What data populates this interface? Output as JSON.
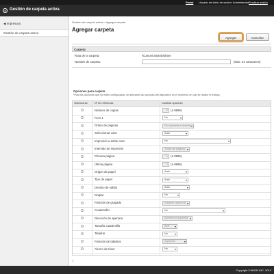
{
  "topbar": {
    "portal": "Portal",
    "user": "Usuario de inicio de sesión: Administrator",
    "logout": "Finalizar sesión"
  },
  "app": {
    "title": "Gestión de carpeta activa"
  },
  "sidebar": {
    "back": "◀ Impresora",
    "active": "Gestión de carpeta activa"
  },
  "breadcrumb": "Gestión de carpeta activa > Agregar carpeta",
  "page_title": "Agregar carpeta",
  "buttons": {
    "ok": "Agregar",
    "cancel": "Cancelar"
  },
  "folder": {
    "header": "Carpeta",
    "route_label": "Ruta de la carpeta:",
    "route_value": "\\\\CanonC5540D\\share",
    "name_label": "Nombre de carpeta:",
    "name_hint": "(Máx. 64 caracteres)"
  },
  "options": {
    "title": "Opciones para carpeta",
    "note": "*Para las opciones que no estén configuradas, se aplicarán las opciones del dispositivo en el momento en que se realice el trabajo.",
    "col_select": "Seleccionar",
    "col_ref": "Nº de referencia",
    "col_change": "Cambiar opciones",
    "rows": [
      {
        "label": "Número de copias",
        "value": "1",
        "range": "(1-9999)"
      },
      {
        "label": "N en 1",
        "value": "No"
      },
      {
        "label": "Orden de páginas",
        "value": "De izquierda a derecha"
      },
      {
        "label": "Seleccionar color",
        "value": "Auto"
      },
      {
        "label": "Impresión a doble cara",
        "value": "No"
      },
      {
        "label": "Intervalo de impresión",
        "value": "Todas las páginas"
      },
      {
        "label": "Primera página",
        "value": "1",
        "range": "(1-9999)"
      },
      {
        "label": "Última página",
        "value": "1",
        "range": "(1-9999)"
      },
      {
        "label": "Origen de papel",
        "value": "Auto"
      },
      {
        "label": "Tipo de papel",
        "value": "Auto"
      },
      {
        "label": "Destino de salida",
        "value": "Auto"
      },
      {
        "label": "Grapar",
        "value": "No"
      },
      {
        "label": "Posición de grapado",
        "value": "Superior izquierda"
      },
      {
        "label": "Cuadernillo",
        "value": "No"
      },
      {
        "label": "Dirección de apertura",
        "value": "Apertura a izquierda"
      },
      {
        "label": "Tamaño cuadernillo",
        "value": "A4R"
      },
      {
        "label": "Taladrar",
        "value": "No"
      },
      {
        "label": "Posición de taladros",
        "value": "Izquierda"
      },
      {
        "label": "Ahorro de tóner",
        "value": "No"
      }
    ]
  },
  "collapse_icon": "↕",
  "footer": {
    "copyright": "Copyright CANON INC. 2019"
  }
}
